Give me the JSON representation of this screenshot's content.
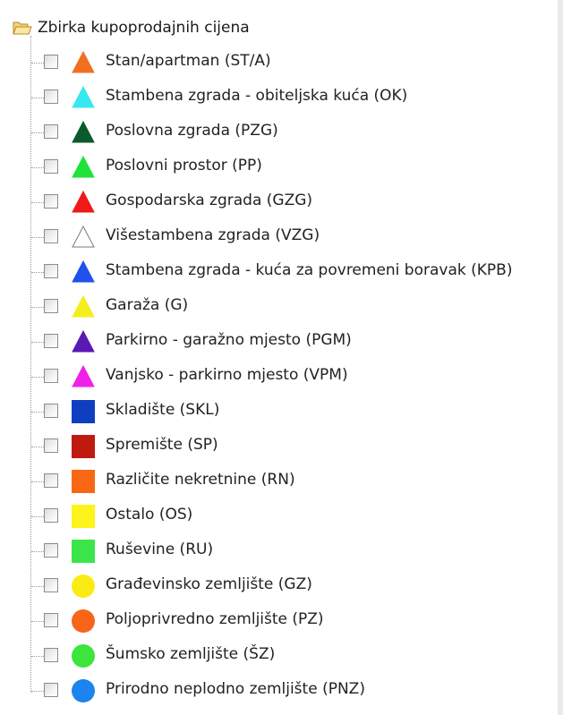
{
  "tree": {
    "root_label": "Zbirka kupoprodajnih cijena",
    "items": [
      {
        "label": "Stan/apartman (ST/A)",
        "shape": "triangle",
        "color": "#f07020",
        "icon": "triangle-orange-icon"
      },
      {
        "label": "Stambena zgrada - obiteljska kuća (OK)",
        "shape": "triangle",
        "color": "#38e8f0",
        "icon": "triangle-cyan-icon"
      },
      {
        "label": "Poslovna zgrada (PZG)",
        "shape": "triangle",
        "color": "#0b5a2e",
        "icon": "triangle-dark-green-icon"
      },
      {
        "label": "Poslovni prostor (PP)",
        "shape": "triangle",
        "color": "#1fe23a",
        "icon": "triangle-green-icon"
      },
      {
        "label": "Gospodarska zgrada (GZG)",
        "shape": "triangle",
        "color": "#f01818",
        "icon": "triangle-red-icon"
      },
      {
        "label": "Višestambena zgrada (VZG)",
        "shape": "triangle-outline",
        "color": "#ffffff",
        "icon": "triangle-white-icon"
      },
      {
        "label": "Stambena zgrada - kuća za povremeni boravak (KPB)",
        "shape": "triangle",
        "color": "#2050ee",
        "icon": "triangle-blue-icon"
      },
      {
        "label": "Garaža (G)",
        "shape": "triangle",
        "color": "#f4ee1c",
        "icon": "triangle-yellow-icon"
      },
      {
        "label": "Parkirno - garažno mjesto (PGM)",
        "shape": "triangle",
        "color": "#5a18b4",
        "icon": "triangle-purple-icon"
      },
      {
        "label": "Vanjsko - parkirno mjesto (VPM)",
        "shape": "triangle",
        "color": "#f020e8",
        "icon": "triangle-magenta-icon"
      },
      {
        "label": "Skladište (SKL)",
        "shape": "square",
        "color": "#0f3ec0",
        "icon": "square-blue-icon"
      },
      {
        "label": "Spremište (SP)",
        "shape": "square",
        "color": "#be1a10",
        "icon": "square-red-icon"
      },
      {
        "label": "Različite nekretnine (RN)",
        "shape": "square",
        "color": "#f86814",
        "icon": "square-orange-icon"
      },
      {
        "label": "Ostalo (OS)",
        "shape": "square",
        "color": "#fcf41c",
        "icon": "square-yellow-icon"
      },
      {
        "label": "Ruševine (RU)",
        "shape": "square",
        "color": "#3ce64a",
        "icon": "square-green-icon"
      },
      {
        "label": "Građevinsko zemljište (GZ)",
        "shape": "circle",
        "color": "#f8ec14",
        "icon": "circle-yellow-icon"
      },
      {
        "label": "Poljoprivredno zemljište (PZ)",
        "shape": "circle",
        "color": "#f86418",
        "icon": "circle-orange-icon"
      },
      {
        "label": "Šumsko zemljište (ŠZ)",
        "shape": "circle",
        "color": "#3ce43c",
        "icon": "circle-green-icon"
      },
      {
        "label": "Prirodno neplodno zemljište (PNZ)",
        "shape": "circle",
        "color": "#1c84ee",
        "icon": "circle-blue-icon"
      }
    ]
  }
}
